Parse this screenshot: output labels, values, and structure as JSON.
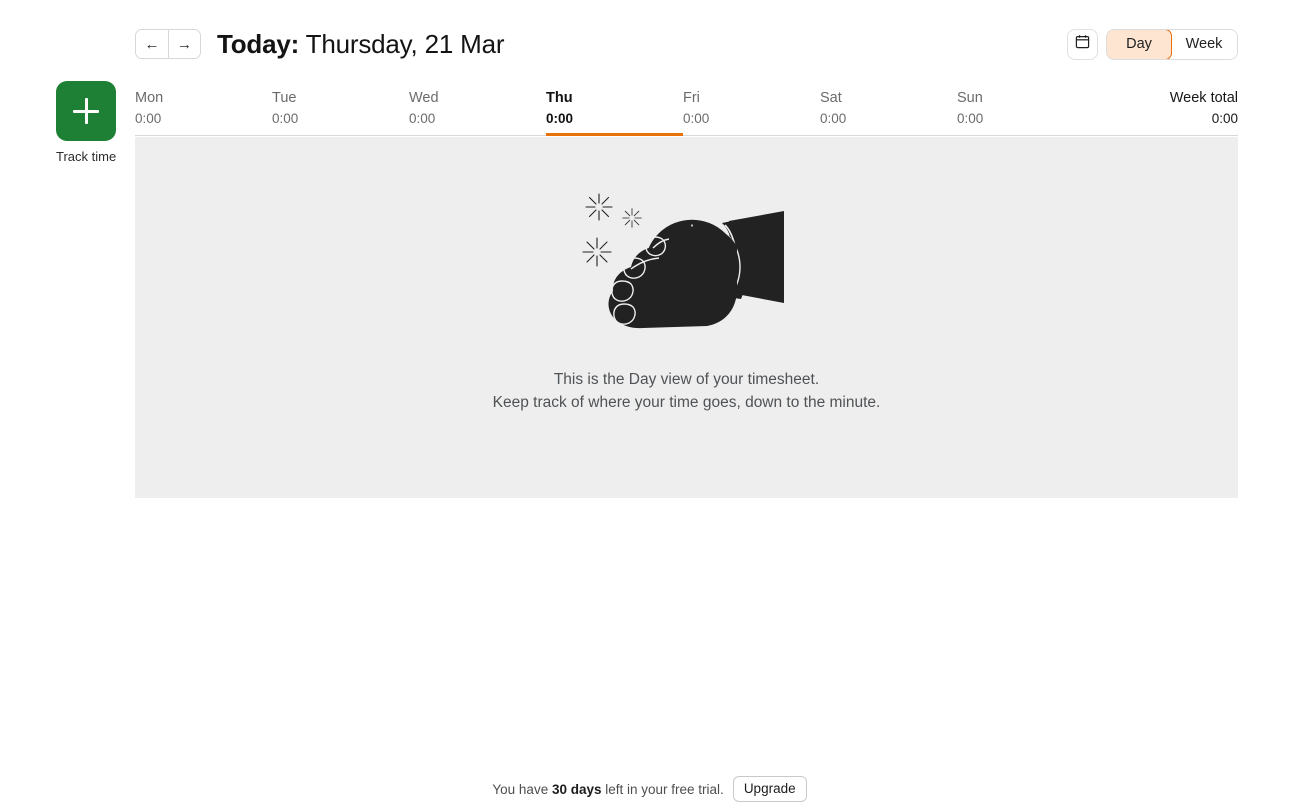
{
  "header": {
    "prev_label": "←",
    "next_label": "→",
    "title_prefix": "Today:",
    "title_date": "Thursday, 21 Mar",
    "calendar_icon": "calendar-icon",
    "view_options": [
      {
        "label": "Day",
        "active": true
      },
      {
        "label": "Week",
        "active": false
      }
    ]
  },
  "track": {
    "icon": "plus-icon",
    "label": "Track time"
  },
  "timesheet": {
    "days": [
      {
        "name": "Mon",
        "time": "0:00",
        "active": false
      },
      {
        "name": "Tue",
        "time": "0:00",
        "active": false
      },
      {
        "name": "Wed",
        "time": "0:00",
        "active": false
      },
      {
        "name": "Thu",
        "time": "0:00",
        "active": true
      },
      {
        "name": "Fri",
        "time": "0:00",
        "active": false
      },
      {
        "name": "Sat",
        "time": "0:00",
        "active": false
      },
      {
        "name": "Sun",
        "time": "0:00",
        "active": false
      }
    ],
    "week_total_label": "Week total",
    "week_total_value": "0:00"
  },
  "empty_state": {
    "illustration": "hand-holding-clock-illustration",
    "line1": "This is the Day view of your timesheet.",
    "line2": "Keep track of where your time goes, down to the minute."
  },
  "trial": {
    "text_before": "You have ",
    "days_left": "30 days",
    "text_after": " left in your free trial.",
    "upgrade_label": "Upgrade"
  },
  "colors": {
    "accent_orange": "#e8710a",
    "accent_orange_bg": "#fde5d2",
    "green": "#1d8034",
    "panel_bg": "#eeeeee"
  }
}
